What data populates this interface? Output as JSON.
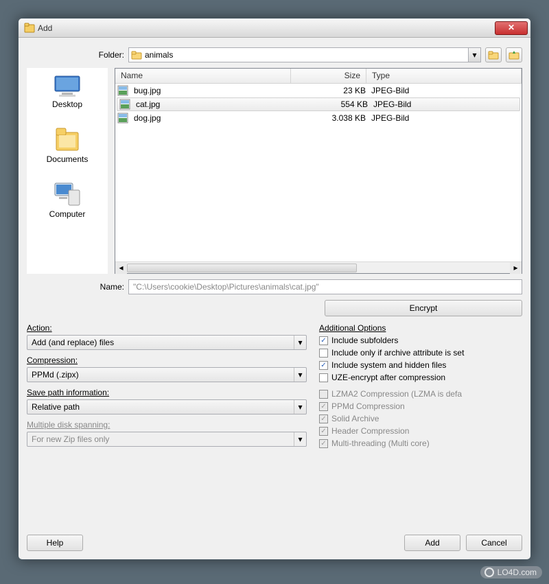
{
  "window": {
    "title": "Add",
    "close_glyph": "✕"
  },
  "folder": {
    "label": "Folder:",
    "value": "animals"
  },
  "places": {
    "desktop": "Desktop",
    "documents": "Documents",
    "computer": "Computer"
  },
  "list": {
    "headers": {
      "name": "Name",
      "size": "Size",
      "type": "Type"
    },
    "rows": [
      {
        "name": "bug.jpg",
        "size": "23 KB",
        "type": "JPEG-Bild",
        "selected": false
      },
      {
        "name": "cat.jpg",
        "size": "554 KB",
        "type": "JPEG-Bild",
        "selected": true
      },
      {
        "name": "dog.jpg",
        "size": "3.038 KB",
        "type": "JPEG-Bild",
        "selected": false
      }
    ]
  },
  "name_field": {
    "label": "Name:",
    "value": "\"C:\\Users\\cookie\\Desktop\\Pictures\\animals\\cat.jpg\""
  },
  "encrypt_label": "Encrypt",
  "left_panel": {
    "action": {
      "label": "Action:",
      "value": "Add (and replace) files"
    },
    "compression": {
      "label": "Compression:",
      "value": "PPMd (.zipx)"
    },
    "savepath": {
      "label": "Save path information:",
      "value": "Relative path"
    },
    "spanning": {
      "label": "Multiple disk spanning:",
      "value": "For new Zip files only"
    }
  },
  "options": {
    "title": "Additional Options",
    "items": [
      {
        "label": "Include subfolders",
        "checked": true,
        "disabled": false
      },
      {
        "label": "Include only if archive attribute is set",
        "checked": false,
        "disabled": false
      },
      {
        "label": "Include system and hidden files",
        "checked": true,
        "disabled": false
      },
      {
        "label": "UZE-encrypt after compression",
        "checked": false,
        "disabled": false
      },
      {
        "label": "LZMA2 Compression (LZMA is defa",
        "checked": false,
        "disabled": true
      },
      {
        "label": "PPMd Compression",
        "checked": true,
        "disabled": true
      },
      {
        "label": "Solid Archive",
        "checked": true,
        "disabled": true
      },
      {
        "label": "Header Compression",
        "checked": true,
        "disabled": true
      },
      {
        "label": "Multi-threading (Multi core)",
        "checked": true,
        "disabled": true
      }
    ]
  },
  "buttons": {
    "help": "Help",
    "add": "Add",
    "cancel": "Cancel"
  },
  "watermark": "LO4D.com",
  "glyphs": {
    "chevron_down": "▾",
    "triangle_left": "◂",
    "triangle_right": "▸",
    "checkmark": "✓"
  }
}
